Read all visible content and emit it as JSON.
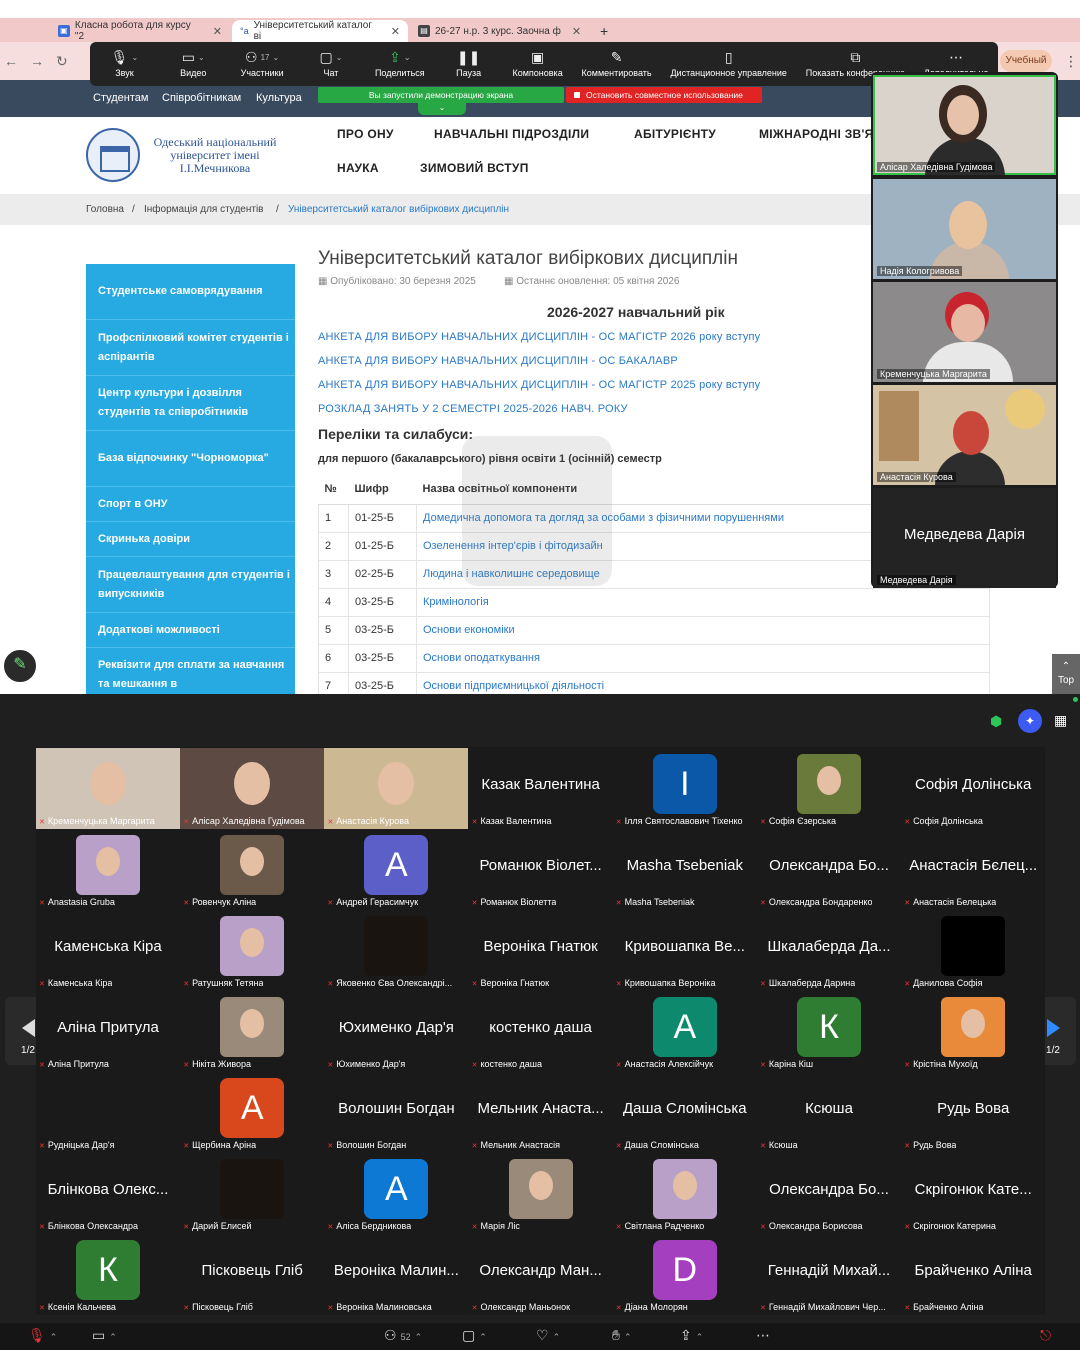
{
  "browser": {
    "tabs": [
      {
        "title": "Класна робота для курсу \"2"
      },
      {
        "title": "Університетський каталог ві"
      },
      {
        "title": "26-27 н.р. 3 курс. Заочна ф"
      }
    ],
    "new_tab": "+",
    "profile_button": "Учебный"
  },
  "zoom_toolbar": {
    "items": [
      {
        "label": "Звук"
      },
      {
        "label": "Видео"
      },
      {
        "label": "Участники",
        "count": "17"
      },
      {
        "label": "Чат"
      },
      {
        "label": "Поделиться"
      },
      {
        "label": "Пауза"
      },
      {
        "label": "Компоновка"
      },
      {
        "label": "Комментировать"
      },
      {
        "label": "Дистанционное управление"
      },
      {
        "label": "Показать конференцию"
      },
      {
        "label": "Дополнительно"
      }
    ],
    "share_notice": "Вы запустили демонстрацию экрана",
    "stop_share": "Остановить совместное использование"
  },
  "site": {
    "top_links": [
      "Студентам",
      "Співробітникам",
      "Культура"
    ],
    "university_name": "Одеський національний університет імені І.І.Мечникова",
    "main_nav": [
      "ПРО ОНУ",
      "НАВЧАЛЬНІ ПІДРОЗДІЛИ",
      "АБІТУРІЄНТУ",
      "МІЖНАРОДНІ ЗВ'Я",
      "НАУКА",
      "ЗИМОВИЙ ВСТУП"
    ],
    "breadcrumb": [
      "Головна",
      "/",
      "Інформація для студентів",
      "/",
      "Університетський каталог вибіркових дисциплін"
    ],
    "sidebar": [
      "Студентське самоврядування",
      "Профспілковий комітет студентів і аспірантів",
      "Центр культури і дозвілля студентів та співробітників",
      "База відпочинку \"Чорноморка\"",
      "Спорт в ОНУ",
      "Скринька довіри",
      "Працевлаштування для студентів і випускників",
      "Додаткові можливості",
      "Реквізити для сплати за навчання та мешкання в"
    ],
    "page_title": "Університетський каталог вибіркових дисциплін",
    "published": "Опубліковано: 30 березня 2025",
    "updated": "Останнє оновлення: 05 квітня 2026",
    "year_heading": "2026-2027 навчальний рік",
    "links": [
      "АНКЕТА ДЛЯ ВИБОРУ НАВЧАЛЬНИХ ДИСЦИПЛІН - ОС МАГІСТР 2026 року вступу",
      "АНКЕТА ДЛЯ ВИБОРУ НАВЧАЛЬНИХ ДИСЦИПЛІН - ОС БАКАЛАВР",
      "АНКЕТА ДЛЯ ВИБОРУ НАВЧАЛЬНИХ ДИСЦИПЛІН - ОС МАГІСТР 2025 року вступу",
      "РОЗКЛАД ЗАНЯТЬ У 2 СЕМЕСТРІ 2025-2026 НАВЧ. РОКУ"
    ],
    "lists_heading": "Переліки та силабуси:",
    "semester_heading": "для першого (бакалаврського) рівня освіти 1 (осінній) семестр",
    "table": {
      "headers": [
        "№",
        "Шифр",
        "Назва освітньої компоненти"
      ],
      "rows": [
        [
          "1",
          "01-25-Б",
          "Домедична допомога та догляд за особами з фізичними порушеннями"
        ],
        [
          "2",
          "01-25-Б",
          "Озеленення інтер'єрів і фітодизайн"
        ],
        [
          "3",
          "02-25-Б",
          "Людина і навколишнє середовище"
        ],
        [
          "4",
          "03-25-Б",
          "Кримінологія"
        ],
        [
          "5",
          "03-25-Б",
          "Основи економіки"
        ],
        [
          "6",
          "03-25-Б",
          "Основи оподаткування"
        ],
        [
          "7",
          "03-25-Б",
          "Основи підприємницької діяльності"
        ]
      ]
    },
    "top_button": "Top"
  },
  "video_strip": [
    {
      "name": "Алісар Халедівна Гудімова"
    },
    {
      "name": "Надія Кологривова"
    },
    {
      "name": "Кременчуцька Маргарита"
    },
    {
      "name": "Анастасія Курова"
    },
    {
      "name": "Медведева Дарія",
      "display": "Медведева Дарія"
    }
  ],
  "gallery": {
    "page": "1/2",
    "cells": [
      {
        "label": "Кременчуцька Маргарита",
        "kind": "video",
        "active": true
      },
      {
        "label": "Алісар Халедівна Гудімова",
        "kind": "video"
      },
      {
        "label": "Анастасія Курова",
        "kind": "video"
      },
      {
        "label": "Казак Валентина",
        "display": "Казак Валентина"
      },
      {
        "label": "Ілля Святославович Тіхенко",
        "avatar": "I",
        "color": "#0b57a8"
      },
      {
        "label": "Софія Єзерська",
        "kind": "photo"
      },
      {
        "label": "Софія Долінська",
        "display": "Софія Долінська"
      },
      {
        "label": "Anastasia Gruba",
        "kind": "photo"
      },
      {
        "label": "Ровенчук Аліна",
        "kind": "photo"
      },
      {
        "label": "Андрей Герасимчук",
        "avatar": "А",
        "color": "#5b5fc7"
      },
      {
        "label": "Романюк Віолетта",
        "display": "Романюк Віолет..."
      },
      {
        "label": "Masha Tsebeniak",
        "display": "Masha Tsebeniak"
      },
      {
        "label": "Олександра Бондаренко",
        "display": "Олександра Бо..."
      },
      {
        "label": "Анастасія Белецька",
        "display": "Анастасія Бєлец..."
      },
      {
        "label": "Каменська Кіра",
        "display": "Каменська Кіра"
      },
      {
        "label": "Ратушняк Тетяна",
        "kind": "photo"
      },
      {
        "label": "Яковенко Єва Олександрі...",
        "kind": "dark"
      },
      {
        "label": "Вероніка Гнатюк",
        "display": "Вероніка Гнатюк"
      },
      {
        "label": "Кривошапка Вероніка",
        "display": "Кривошапка Ве..."
      },
      {
        "label": "Шкалаберда Дарина",
        "display": "Шкалаберда Да..."
      },
      {
        "label": "Данилова Софія",
        "kind": "black"
      },
      {
        "label": "Аліна Притула",
        "display": "Аліна Притула"
      },
      {
        "label": "Нікіта Живора",
        "kind": "photo"
      },
      {
        "label": "Юхименко Дар'я",
        "display": "Юхименко Дар'я"
      },
      {
        "label": "костенко даша",
        "display": "костенко даша"
      },
      {
        "label": "Анастасія Алексійчук",
        "avatar": "А",
        "color": "#0d8a6e"
      },
      {
        "label": "Каріна Кіш",
        "avatar": "К",
        "color": "#2e7d32"
      },
      {
        "label": "Крістіна Мухоїд",
        "kind": "photo"
      },
      {
        "label": "Рудніцька Дар'я",
        "kind": "blank"
      },
      {
        "label": "Щербина Аріна",
        "avatar": "А",
        "color": "#d9481c"
      },
      {
        "label": "Волошин Богдан",
        "display": "Волошин Богдан"
      },
      {
        "label": "Мельник Анастасія",
        "display": "Мельник Анаста..."
      },
      {
        "label": "Даша Сломінська",
        "display": "Даша Сломінська"
      },
      {
        "label": "Ксюша",
        "display": "Ксюша"
      },
      {
        "label": "Рудь Вова",
        "display": "Рудь Вова"
      },
      {
        "label": "Блінкова Олександра",
        "display": "Блінкова Олекс..."
      },
      {
        "label": "Дарий Елисей",
        "kind": "dark"
      },
      {
        "label": "Аліса Бердникова",
        "avatar": "А",
        "color": "#0e78d5"
      },
      {
        "label": "Марія Ліс",
        "kind": "photo"
      },
      {
        "label": "Світлана Радченко",
        "kind": "photo"
      },
      {
        "label": "Олександра Борисова",
        "display": "Олександра Бо..."
      },
      {
        "label": "Скрігонюк Катерина",
        "display": "Скрігонюк Кате..."
      },
      {
        "label": "Ксенія Кальчева",
        "avatar": "К",
        "color": "#2e7d32"
      },
      {
        "label": "Пісковець Гліб",
        "display": "Пісковець Гліб"
      },
      {
        "label": "Вероніка Малиновська",
        "display": "Вероніка Малин..."
      },
      {
        "label": "Олександр Маньонок",
        "display": "Олександр Ман..."
      },
      {
        "label": "Діана Молорян",
        "avatar": "D",
        "color": "#a43fbf"
      },
      {
        "label": "Геннадій Михайлович Чер...",
        "display": "Геннадій Михай..."
      },
      {
        "label": "Брайченко Аліна",
        "display": "Брайченко Аліна"
      }
    ]
  },
  "bottom_bar": {
    "participants_count": "52"
  }
}
